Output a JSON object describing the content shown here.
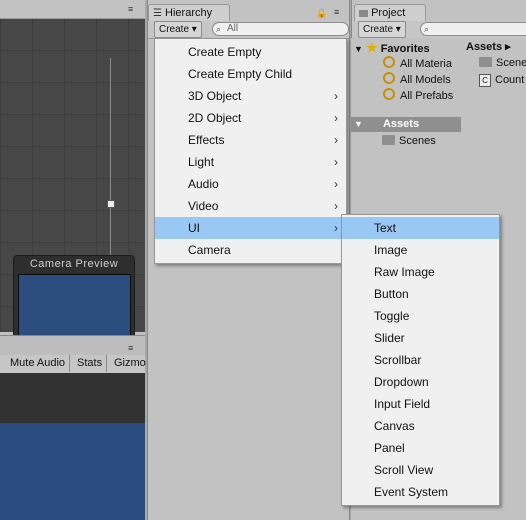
{
  "scene": {
    "menu_icon": "≡",
    "camera_preview": {
      "title": "Camera Preview"
    }
  },
  "game": {
    "menu_icon": "≡",
    "toolbar": {
      "mute": "Mute Audio",
      "stats": "Stats",
      "gizmos": "Gizmo"
    }
  },
  "hierarchy": {
    "tab_label": "Hierarchy",
    "tab_icon": "list-icon",
    "create_label": "Create ▾",
    "search_placeholder": "All",
    "lock_icon": "🔒",
    "menu_icon": "≡"
  },
  "project": {
    "tab_label": "Project",
    "create_label": "Create ▾",
    "favorites": {
      "label": "Favorites",
      "items": [
        "All Materia",
        "All Models",
        "All Prefabs"
      ]
    },
    "assets_tree": {
      "label": "Assets",
      "children": [
        "Scenes"
      ]
    },
    "breadcrumb": "Assets ▸",
    "right_items": [
      "Scene",
      "Count"
    ]
  },
  "create_menu": {
    "items": [
      {
        "label": "Create Empty",
        "submenu": false
      },
      {
        "label": "Create Empty Child",
        "submenu": false
      },
      {
        "label": "3D Object",
        "submenu": true
      },
      {
        "label": "2D Object",
        "submenu": true
      },
      {
        "label": "Effects",
        "submenu": true
      },
      {
        "label": "Light",
        "submenu": true
      },
      {
        "label": "Audio",
        "submenu": true
      },
      {
        "label": "Video",
        "submenu": true
      },
      {
        "label": "UI",
        "submenu": true,
        "selected": true
      },
      {
        "label": "Camera",
        "submenu": false
      }
    ],
    "arrow": "›"
  },
  "ui_submenu": {
    "items": [
      "Text",
      "Image",
      "Raw Image",
      "Button",
      "Toggle",
      "Slider",
      "Scrollbar",
      "Dropdown",
      "Input Field",
      "Canvas",
      "Panel",
      "Scroll View",
      "Event System"
    ],
    "selected_index": 0
  },
  "colors": {
    "menu_highlight": "#99c8f4",
    "scene_bg": "#474747",
    "game_blue": "#2a4c7e"
  }
}
